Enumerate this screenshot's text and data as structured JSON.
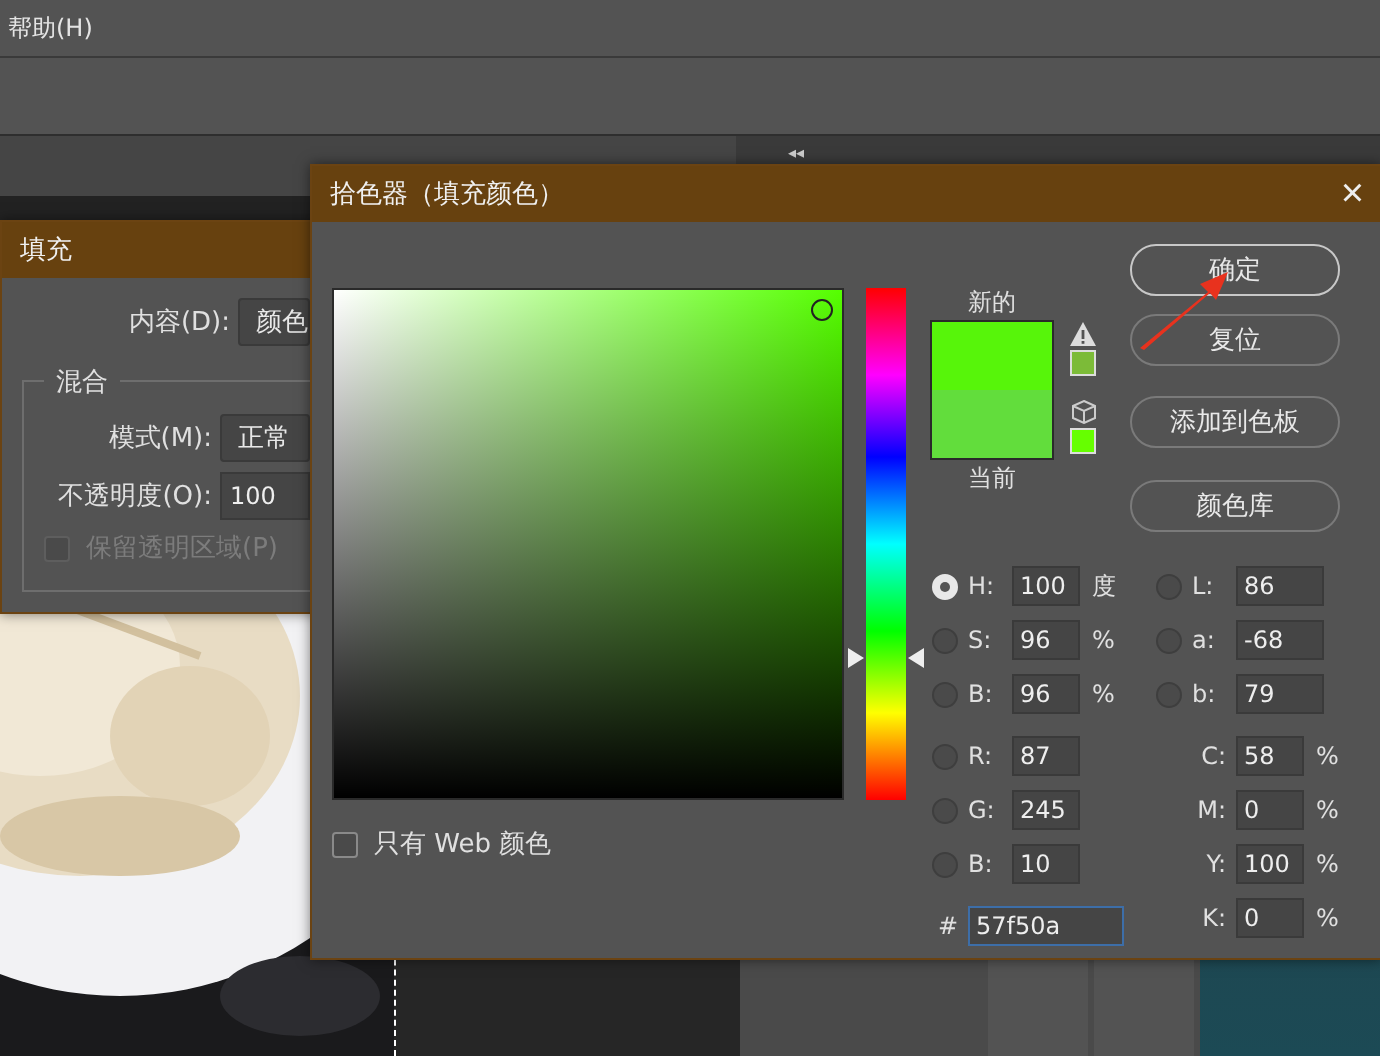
{
  "menu_bar": {
    "items": [
      "帮助(H)"
    ]
  },
  "panel_collapse": "◂◂",
  "fill_dialog": {
    "title": "填充",
    "content": {
      "label": "内容(D):",
      "value": "颜色"
    },
    "blend_group": {
      "title": "混合",
      "mode": {
        "label": "模式(M):",
        "value": "正常"
      },
      "opacity": {
        "label": "不透明度(O):",
        "value": "100"
      },
      "preserve_transparency": {
        "label": "保留透明区域(P)",
        "checked": false,
        "disabled": true
      }
    }
  },
  "color_picker": {
    "title": "拾色器（填充颜色）",
    "close": "×",
    "field": {
      "saturation": {
        "level": 0.96
      },
      "brightness": {
        "level": 0.96
      }
    },
    "hue_slider": {
      "level": 0.278
    },
    "new_label": "新的",
    "current_label": "当前",
    "buttons": [
      {
        "label": "确定",
        "default": true
      },
      {
        "label": "复位",
        "default": false
      },
      {
        "label": "添加到色板",
        "default": false
      },
      {
        "label": "颜色库",
        "default": false
      }
    ],
    "hsb": [
      {
        "label": "H:",
        "value": "100",
        "unit": "度",
        "selected": true
      },
      {
        "label": "S:",
        "value": "96",
        "unit": "%",
        "selected": false
      },
      {
        "label": "B:",
        "value": "96",
        "unit": "%",
        "selected": false
      }
    ],
    "lab": [
      {
        "label": "L:",
        "value": "86",
        "selected": false
      },
      {
        "label": "a:",
        "value": "-68",
        "selected": false
      },
      {
        "label": "b:",
        "value": "79",
        "selected": false
      }
    ],
    "rgb": [
      {
        "label": "R:",
        "value": "87",
        "selected": false
      },
      {
        "label": "G:",
        "value": "245",
        "selected": false
      },
      {
        "label": "B:",
        "value": "10",
        "selected": false
      }
    ],
    "cmyk": [
      {
        "label": "C:",
        "value": "58",
        "unit": "%"
      },
      {
        "label": "M:",
        "value": "0",
        "unit": "%"
      },
      {
        "label": "Y:",
        "value": "100",
        "unit": "%"
      },
      {
        "label": "K:",
        "value": "0",
        "unit": "%"
      }
    ],
    "hex": {
      "label": "#",
      "value": "57f50a"
    },
    "web_only": {
      "label": "只有 Web 颜色",
      "checked": false
    }
  }
}
